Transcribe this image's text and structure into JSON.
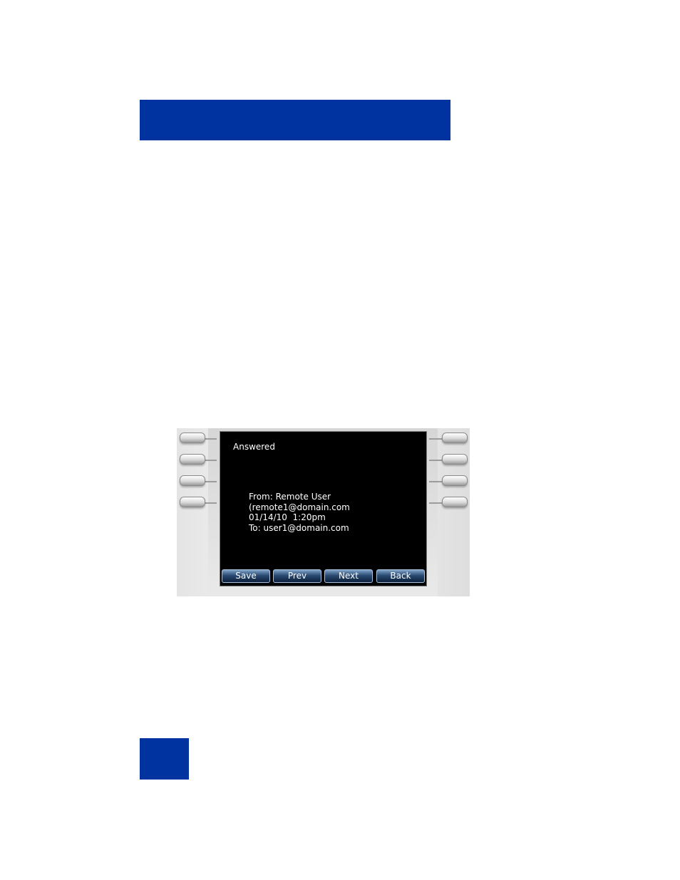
{
  "screen": {
    "title": "Answered",
    "message": {
      "from_line": "From: Remote User",
      "email_line": "(remote1@domain.com",
      "datetime_line": "01/14/10  1:20pm",
      "to_line": "To: user1@domain.com"
    },
    "softkeys": [
      "Save",
      "Prev",
      "Next",
      "Back"
    ]
  },
  "colors": {
    "brand_blue": "#0033a0",
    "screen_background": "#000000",
    "softkey_blue": "#2a4a72"
  }
}
